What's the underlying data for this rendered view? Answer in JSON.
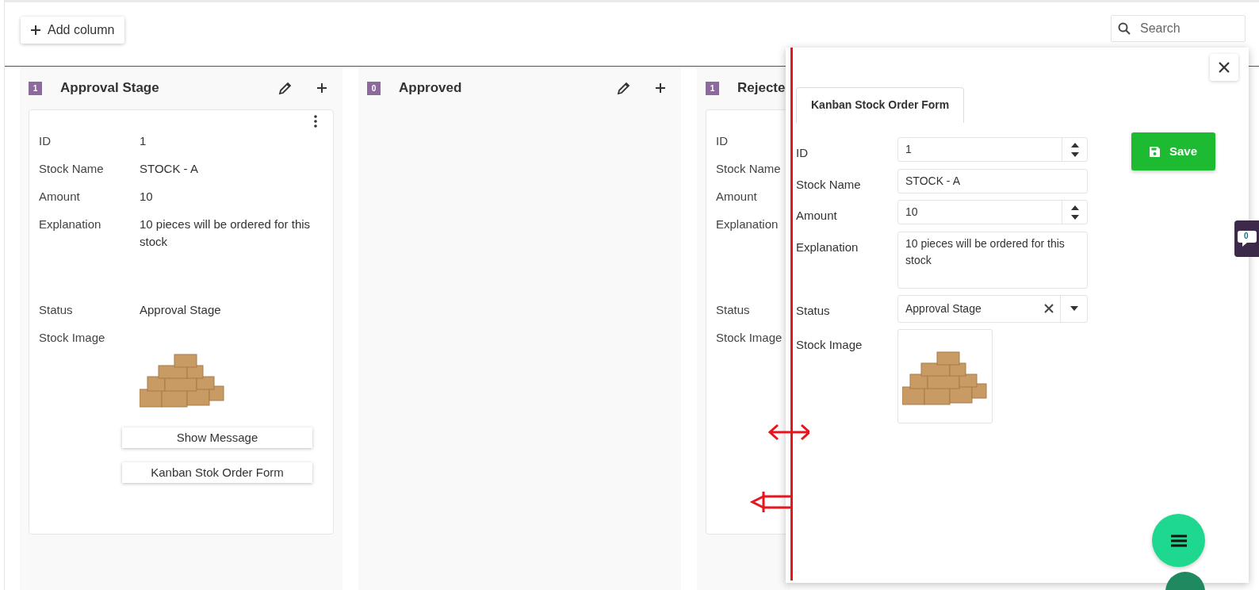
{
  "toolbar": {
    "add_button": "Add column",
    "search": {
      "placeholder": "Search"
    }
  },
  "columns": [
    {
      "count": "1",
      "title": "Approval Stage",
      "cut_off": false,
      "cards": [
        {
          "fields": [
            {
              "label": "ID",
              "kind": "text",
              "value": "1"
            },
            {
              "label": "Stock Name",
              "kind": "text",
              "value": "STOCK - A"
            },
            {
              "label": "Amount",
              "kind": "text",
              "value": "10"
            },
            {
              "label": "Explanation",
              "kind": "text",
              "value": "10 pieces will be ordered for this stock"
            },
            {
              "label": "Status",
              "kind": "text",
              "value": "Approval Stage"
            },
            {
              "label": "Stock Image",
              "kind": "image"
            }
          ],
          "buttons": [
            "Show Message",
            "Kanban Stok Order Form"
          ]
        }
      ]
    },
    {
      "count": "0",
      "title": "Approved",
      "cut_off": false
    },
    {
      "count": "1",
      "title": "Rejecte",
      "cut_off": true,
      "cards": [
        {
          "fields": [
            {
              "label": "ID",
              "kind": "text"
            },
            {
              "label": "Stock Name",
              "kind": "text"
            },
            {
              "label": "Amount",
              "kind": "text"
            },
            {
              "label": "Explanation",
              "kind": "text"
            },
            {
              "label": "Status",
              "kind": "text"
            },
            {
              "label": "Stock Image",
              "kind": "image"
            }
          ]
        }
      ]
    }
  ],
  "form": {
    "tab": "Kanban Stock Order Form",
    "save_button": "Save",
    "fields": [
      {
        "label": "ID",
        "kind": "number",
        "value": "1"
      },
      {
        "label": "Stock Name",
        "kind": "text",
        "value": "STOCK - A"
      },
      {
        "label": "Amount",
        "kind": "number",
        "value": "10"
      },
      {
        "label": "Explanation",
        "kind": "textarea",
        "value": "10 pieces will be ordered for this stock"
      },
      {
        "label": "Status",
        "kind": "select",
        "value": "Approval Stage"
      },
      {
        "label": "Stock Image",
        "kind": "image"
      }
    ]
  },
  "chat": {
    "count": "0"
  }
}
